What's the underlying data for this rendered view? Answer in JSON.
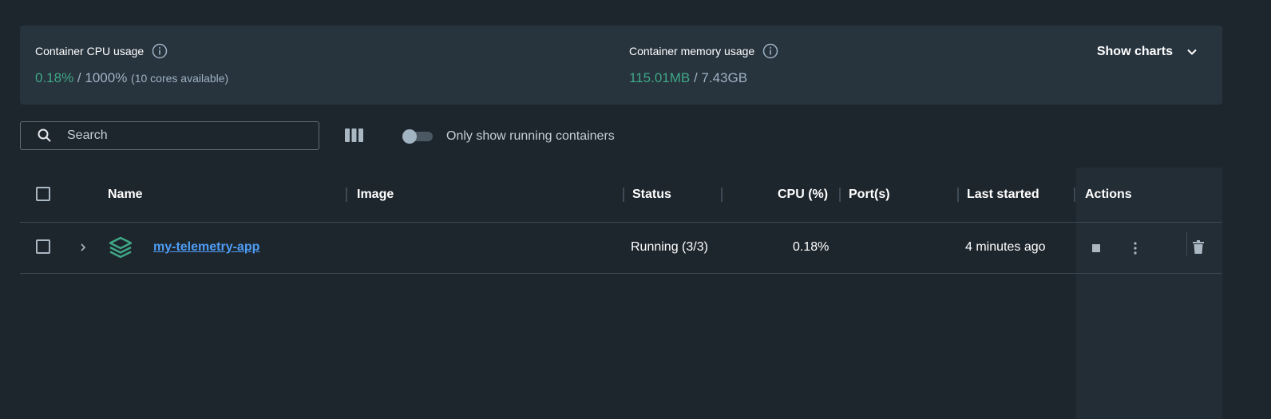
{
  "stats": {
    "cpu": {
      "label": "Container CPU usage",
      "used": "0.18%",
      "separator": " / ",
      "total": "1000%",
      "note": "(10 cores available)"
    },
    "memory": {
      "label": "Container memory usage",
      "used": "115.01MB",
      "separator": " / ",
      "total": "7.43GB"
    },
    "show_charts_label": "Show charts"
  },
  "toolbar": {
    "search_placeholder": "Search",
    "toggle_label": "Only show running containers",
    "toggle_on": false
  },
  "table": {
    "headers": {
      "name": "Name",
      "image": "Image",
      "status": "Status",
      "cpu": "CPU (%)",
      "ports": "Port(s)",
      "last_started": "Last started",
      "actions": "Actions"
    },
    "rows": [
      {
        "name": "my-telemetry-app",
        "image": "",
        "status": "Running (3/3)",
        "cpu": "0.18%",
        "ports": "",
        "last_started": "4 minutes ago"
      }
    ]
  },
  "colors": {
    "accent_green": "#3fa886",
    "link_blue": "#4e9df5",
    "background": "#1e262d",
    "panel": "#27333d"
  },
  "icons": {
    "info": "info-icon",
    "chevron": "chevron-down-icon",
    "search": "search-icon",
    "columns": "columns-icon",
    "expand": "chevron-right-icon",
    "stack": "stack-icon",
    "stop": "stop-icon",
    "more": "more-vertical-icon",
    "delete": "trash-icon"
  }
}
